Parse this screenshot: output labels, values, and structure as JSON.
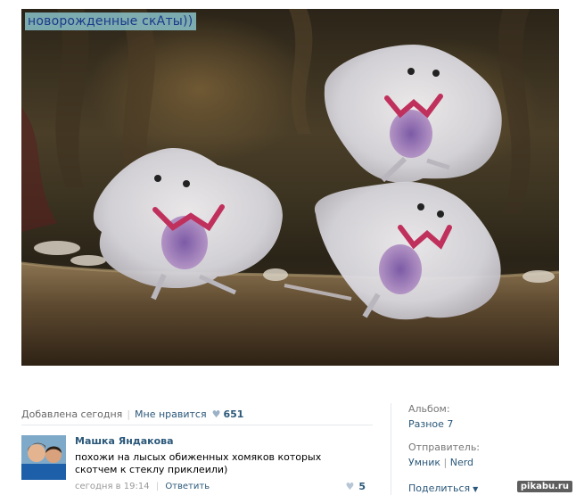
{
  "post": {
    "image_caption": "новорожденные скАты))",
    "added_text": "Добавлена сегодня",
    "like_label": "Мне нравится",
    "like_count": "651"
  },
  "comment": {
    "author": "Машка Яндакова",
    "text": "похожи на лысых обиженных хомяков которых скотчем к стеклу приклеили)",
    "time": "сегодня в 19:14",
    "reply_label": "Ответить",
    "likes": "5"
  },
  "sidebar": {
    "album_label": "Альбом:",
    "album_value": "Разное 7",
    "sender_label": "Отправитель:",
    "sender_user": "Умник",
    "sender_separator": "|",
    "sender_group": "Nerd",
    "share_label": "Поделиться"
  },
  "watermark": "pikabu.ru",
  "icons": {
    "heart": "heart-icon",
    "dropdown": "chevron-down-icon"
  },
  "colors": {
    "link": "#2b587a",
    "muted": "#666666",
    "caption_bg": "#96d7e1"
  }
}
